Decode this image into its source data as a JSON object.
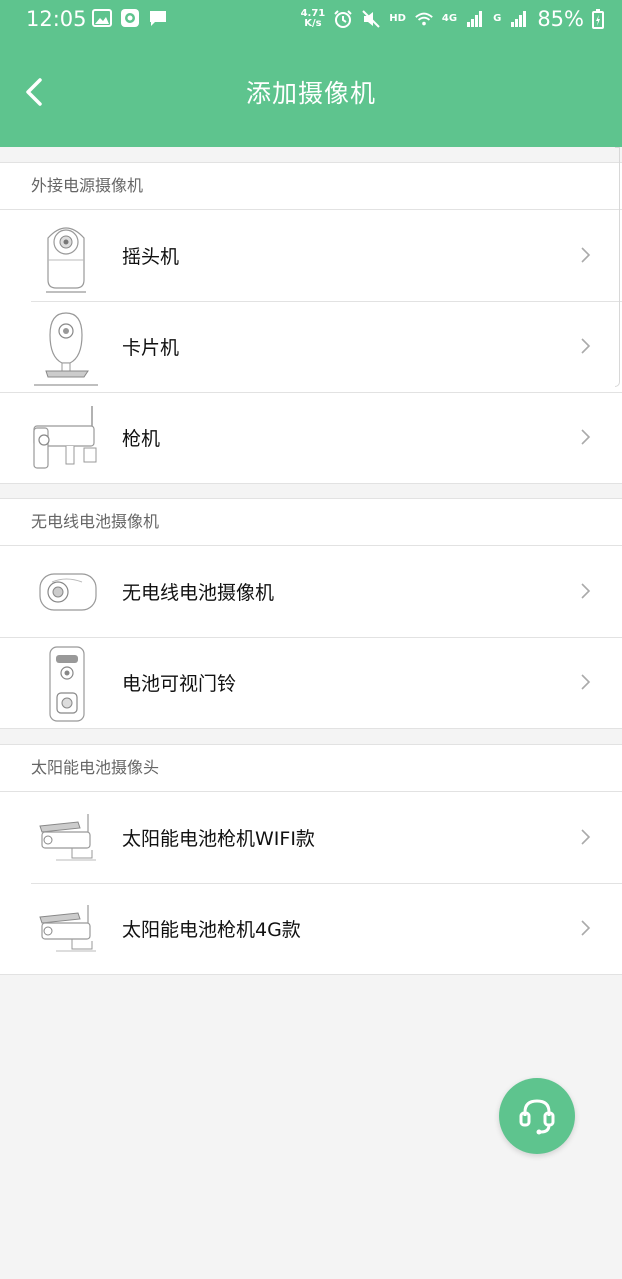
{
  "status_bar": {
    "time": "12:05",
    "net_speed_value": "4.71",
    "net_speed_unit": "K/s",
    "hd_label": "HD",
    "signal_label_1": "4G",
    "signal_label_2": "G",
    "battery": "85%"
  },
  "header": {
    "title": "添加摄像机",
    "back_icon": "chevron-left-icon"
  },
  "sections": [
    {
      "title": "外接电源摄像机",
      "items": [
        {
          "label": "摇头机",
          "icon": "ptz-camera-icon"
        },
        {
          "label": "卡片机",
          "icon": "card-camera-icon"
        },
        {
          "label": "枪机",
          "icon": "bullet-camera-icon"
        }
      ]
    },
    {
      "title": "无电线电池摄像机",
      "items": [
        {
          "label": "无电线电池摄像机",
          "icon": "battery-camera-icon"
        },
        {
          "label": "电池可视门铃",
          "icon": "video-doorbell-icon"
        }
      ]
    },
    {
      "title": "太阳能电池摄像头",
      "items": [
        {
          "label": "太阳能电池枪机WIFI款",
          "icon": "solar-bullet-camera-icon"
        },
        {
          "label": "太阳能电池枪机4G款",
          "icon": "solar-bullet-camera-icon"
        }
      ]
    }
  ],
  "fab": {
    "icon": "customer-service-headset-icon"
  },
  "colors": {
    "accent": "#5ec48e",
    "background": "#f4f4f4"
  }
}
